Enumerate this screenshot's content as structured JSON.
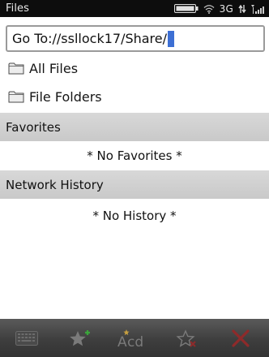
{
  "status_bar": {
    "title": "Files",
    "network": "3G",
    "icons": [
      "battery-icon",
      "wifi-icon",
      "data-transfer-icon",
      "signal-icon"
    ]
  },
  "goto": {
    "value": "Go To://ssllock17/Share/"
  },
  "files": [
    {
      "label": "All Files",
      "icon": "folder-icon"
    },
    {
      "label": "File Folders",
      "icon": "folder-icon"
    }
  ],
  "favorites": {
    "header": "Favorites",
    "empty": "* No Favorites *"
  },
  "history": {
    "header": "Network History",
    "empty": "* No History *"
  },
  "toolbar": {
    "buttons": [
      "keyboard-icon",
      "add-favorite-icon",
      "rename-icon",
      "delete-favorite-icon",
      "close-icon"
    ]
  },
  "colors": {
    "status_bar": "#0d0d0d",
    "section_header": "#d0d0d0",
    "caret": "#3d6fd4",
    "toolbar": "#3e3e3e",
    "close_red": "#8e2a2a"
  }
}
